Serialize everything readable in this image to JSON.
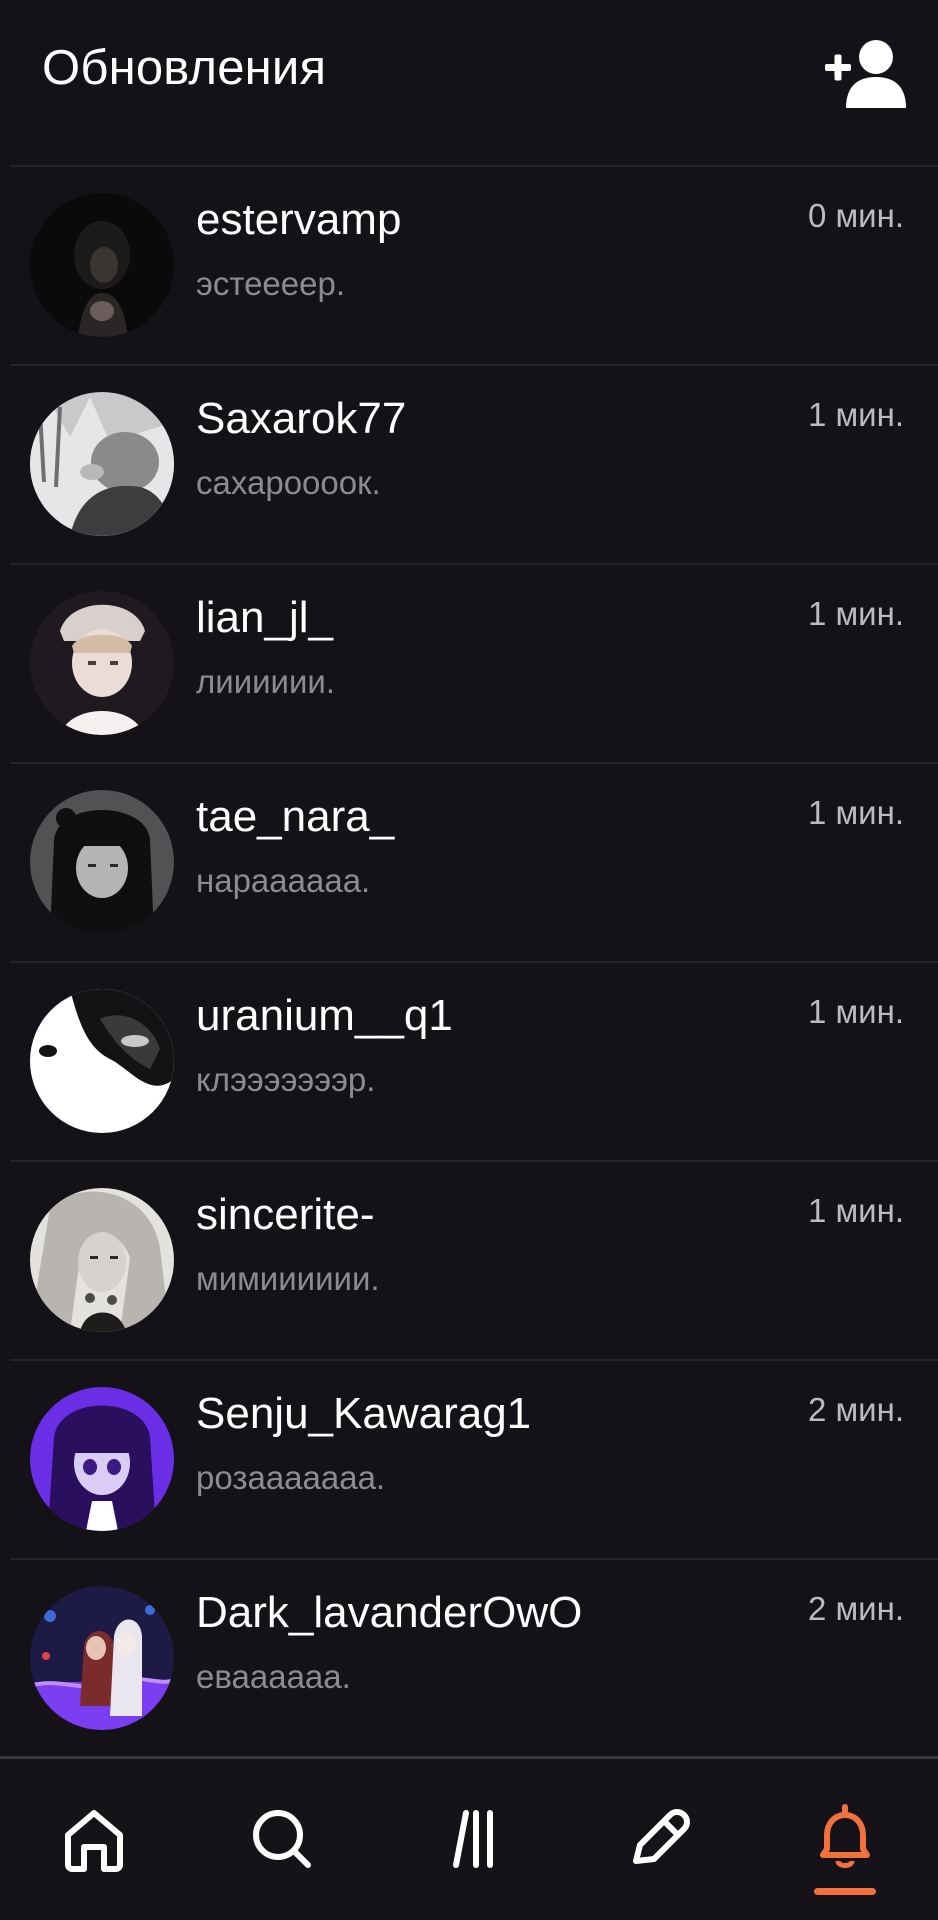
{
  "header": {
    "title": "Обновления",
    "add_friend_icon": "add-person-icon"
  },
  "updates": [
    {
      "username": "estervamp",
      "message": "эстеееер.",
      "time": "0 мин."
    },
    {
      "username": "Saxarok77",
      "message": "сахароооок.",
      "time": "1 мин."
    },
    {
      "username": "lian_jl_",
      "message": "лииииии.",
      "time": "1 мин."
    },
    {
      "username": "tae_nara_",
      "message": "нараааааа.",
      "time": "1 мин."
    },
    {
      "username": "uranium__q1",
      "message": "клэээээээр.",
      "time": "1 мин."
    },
    {
      "username": "sincerite-",
      "message": "мимииииии.",
      "time": "1 мин."
    },
    {
      "username": "Senju_Kawarag1",
      "message": "розааааааа.",
      "time": "2 мин."
    },
    {
      "username": "Dark_lavanderOwO",
      "message": "еваааааа.",
      "time": "2 мин."
    }
  ],
  "bottom_nav": {
    "items": [
      "home-icon",
      "search-icon",
      "feed-icon",
      "pencil-icon",
      "bell-icon"
    ],
    "active": "bell-icon"
  },
  "colors": {
    "background": "#141216",
    "accent": "#f0713d",
    "divider": "#252327",
    "secondary_text": "#8d8b90"
  }
}
